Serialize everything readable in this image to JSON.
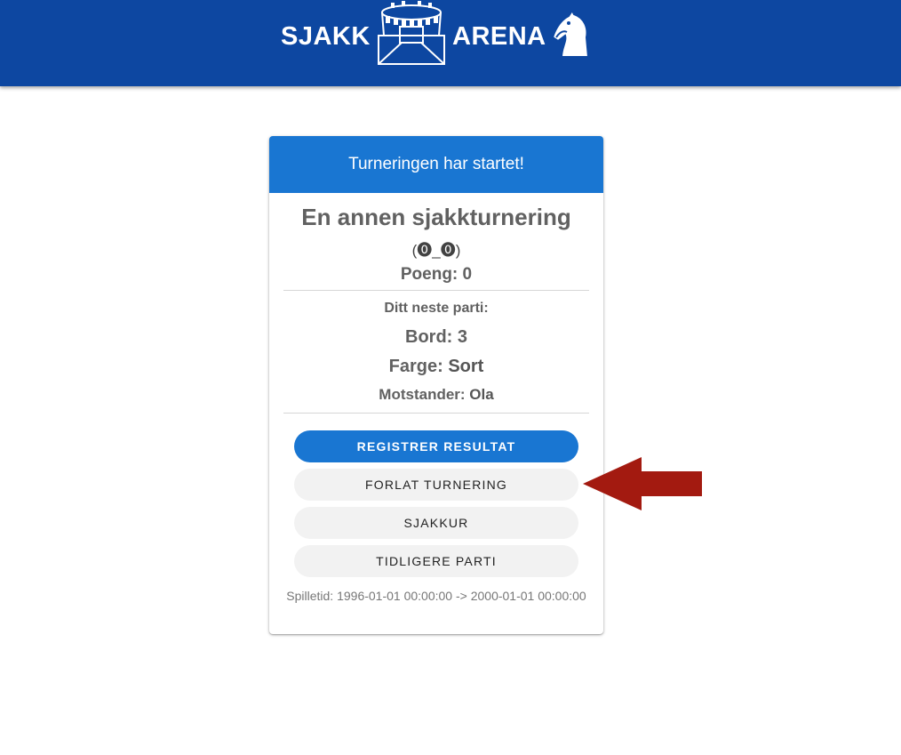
{
  "header": {
    "logo_word_left": "SJAKK",
    "logo_word_right": "ARENA",
    "logo_icons": [
      "stadium-icon",
      "knight-icon"
    ],
    "background_color": "#0d47a1"
  },
  "card": {
    "status_banner": "Turneringen har startet!",
    "tournament_name": "En annen sjakkturnering",
    "face_text": "(⓿_⓿)",
    "points_label": "Poeng: 0",
    "next_game_label": "Ditt neste parti:",
    "board_label": "Bord: 3",
    "color_prefix": "Farge: ",
    "color_value": "Sort",
    "opponent_prefix": "Motstander: ",
    "opponent_value": "Ola",
    "buttons": {
      "register_result": "REGISTRER RESULTAT",
      "leave_tournament": "FORLAT TURNERING",
      "chess_clock": "SJAKKUR",
      "previous_games": "TIDLIGERE PARTI"
    },
    "playtime": "Spilletid: 1996-01-01 00:00:00 -> 2000-01-01 00:00:00"
  },
  "annotation": {
    "icon": "left-arrow-icon",
    "color": "#a31a10"
  },
  "colors": {
    "accent": "#1976d2",
    "header": "#0d47a1"
  }
}
